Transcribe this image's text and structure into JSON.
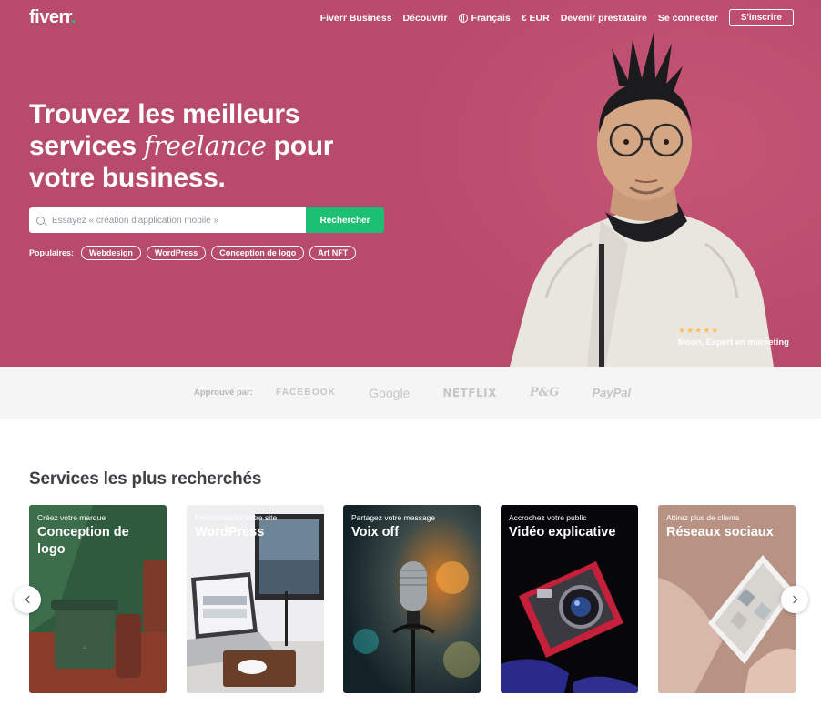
{
  "header": {
    "logo_text": "fiverr",
    "logo_dot": ".",
    "nav": {
      "business": "Fiverr Business",
      "explore": "Découvrir",
      "language": "Français",
      "currency": "€ EUR",
      "become_seller": "Devenir prestataire",
      "sign_in": "Se connecter",
      "join": "S'inscrire"
    }
  },
  "hero": {
    "headline_part1": "Trouvez les meilleurs services ",
    "headline_italic": "freelance",
    "headline_part2": " pour votre business.",
    "search_placeholder": "Essayez « création d'application mobile »",
    "search_button": "Rechercher",
    "popular_label": "Populaires:",
    "popular_tags": [
      "Webdesign",
      "WordPress",
      "Conception de logo",
      "Art NFT"
    ],
    "rating_stars": "★★★★★",
    "person_caption": "Moon, Expert en marketing",
    "background_color": "#b84a6c"
  },
  "trusted_by": {
    "label": "Approuvé par:",
    "brands": [
      "FACEBOOK",
      "Google",
      "NETFLIX",
      "P&G",
      "PayPal"
    ]
  },
  "services": {
    "title": "Services les plus recherchés",
    "cards": [
      {
        "subtitle": "Créez votre marque",
        "title": "Conception de logo"
      },
      {
        "subtitle": "Personnalisez votre site",
        "title": "WordPress"
      },
      {
        "subtitle": "Partagez votre message",
        "title": "Voix off"
      },
      {
        "subtitle": "Accrochez votre public",
        "title": "Vidéo explicative"
      },
      {
        "subtitle": "Attirez plus de clients",
        "title": "Réseaux sociaux"
      }
    ],
    "prev_icon": "chevron-left-icon",
    "next_icon": "chevron-right-icon"
  },
  "colors": {
    "brand_green": "#1dbf73",
    "hero_pink": "#b84a6c",
    "text_dark": "#404145"
  }
}
